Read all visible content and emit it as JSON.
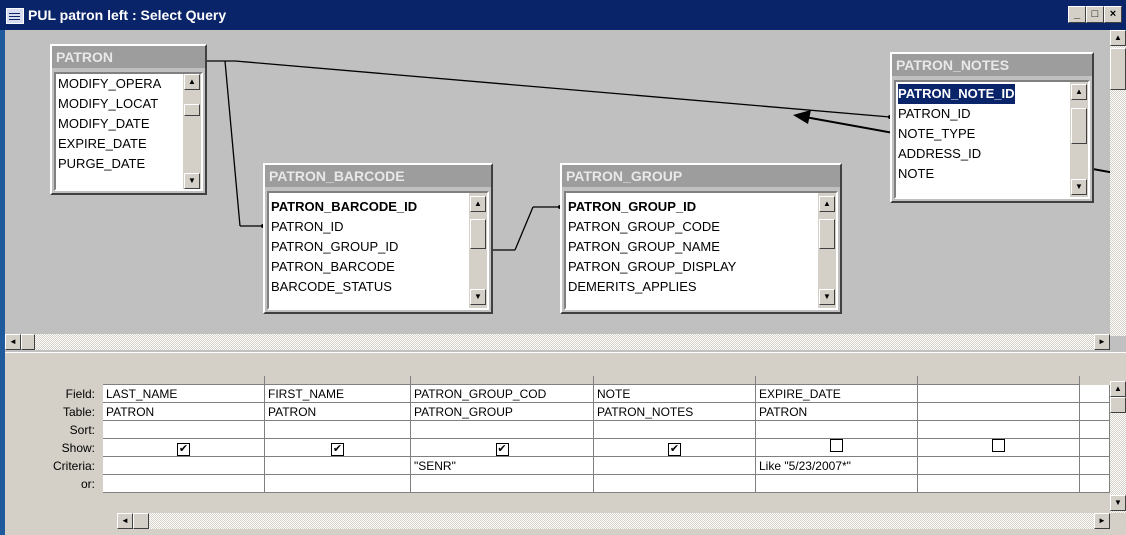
{
  "window": {
    "title": "PUL patron left : Select Query",
    "buttons": {
      "minimize": "_",
      "restore": "□",
      "close": "×"
    }
  },
  "tables": {
    "patron": {
      "name": "PATRON",
      "fields": [
        "MODIFY_OPERA",
        "MODIFY_LOCAT",
        "MODIFY_DATE",
        "EXPIRE_DATE",
        "PURGE_DATE"
      ]
    },
    "patron_barcode": {
      "name": "PATRON_BARCODE",
      "fields": [
        "PATRON_BARCODE_ID",
        "PATRON_ID",
        "PATRON_GROUP_ID",
        "PATRON_BARCODE",
        "BARCODE_STATUS"
      ]
    },
    "patron_group": {
      "name": "PATRON_GROUP",
      "fields": [
        "PATRON_GROUP_ID",
        "PATRON_GROUP_CODE",
        "PATRON_GROUP_NAME",
        "PATRON_GROUP_DISPLAY",
        "DEMERITS_APPLIES"
      ]
    },
    "patron_notes": {
      "name": "PATRON_NOTES",
      "fields": [
        "PATRON_NOTE_ID",
        "PATRON_ID",
        "NOTE_TYPE",
        "ADDRESS_ID",
        "NOTE"
      ],
      "selected_field": "PATRON_NOTE_ID"
    }
  },
  "grid": {
    "row_labels": {
      "field": "Field:",
      "table": "Table:",
      "sort": "Sort:",
      "show": "Show:",
      "criteria": "Criteria:",
      "or": "or:"
    },
    "columns": [
      {
        "field": "LAST_NAME",
        "table": "PATRON",
        "sort": "",
        "show": true,
        "criteria": "",
        "or": ""
      },
      {
        "field": "FIRST_NAME",
        "table": "PATRON",
        "sort": "",
        "show": true,
        "criteria": "",
        "or": ""
      },
      {
        "field": "PATRON_GROUP_COD",
        "table": "PATRON_GROUP",
        "sort": "",
        "show": true,
        "criteria": "\"SENR\"",
        "or": ""
      },
      {
        "field": "NOTE",
        "table": "PATRON_NOTES",
        "sort": "",
        "show": true,
        "criteria": "",
        "or": ""
      },
      {
        "field": "EXPIRE_DATE",
        "table": "PATRON",
        "sort": "",
        "show": false,
        "criteria": "Like \"5/23/2007*\"",
        "or": ""
      },
      {
        "field": "",
        "table": "",
        "sort": "",
        "show": false,
        "criteria": "",
        "or": ""
      }
    ]
  },
  "colors": {
    "titlebar": "#0a246a",
    "background": "#1f5a9c",
    "design_area": "#c0c0c0",
    "table_header": "#9d9d9d"
  }
}
